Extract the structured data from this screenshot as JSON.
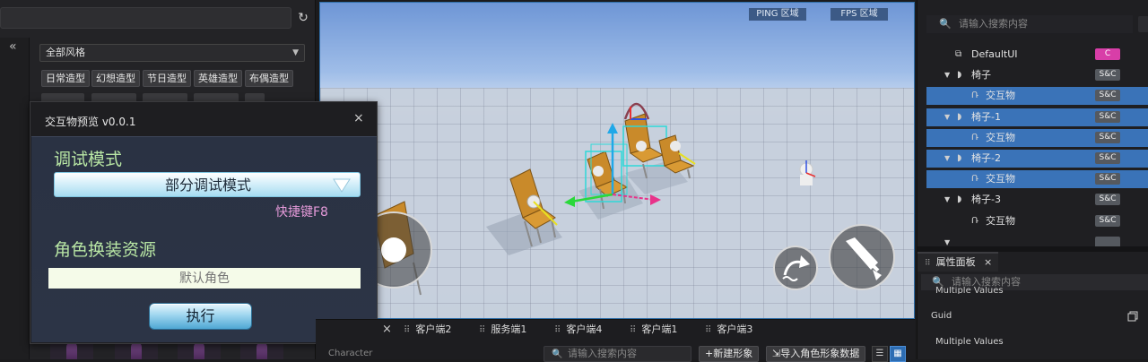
{
  "left_panel": {
    "refresh_icon": "↻",
    "collapse_icon": "«",
    "style_filter": "全部风格",
    "style_chips": [
      "日常造型",
      "幻想造型",
      "节日造型",
      "英雄造型",
      "布偶造型"
    ],
    "thumbnail_icon": "character-thumbnail"
  },
  "popup": {
    "title": "交互物预览 v0.0.1",
    "close": "×",
    "debug_section_label": "调试模式",
    "debug_mode_value": "部分调试模式",
    "shortcut_hint": "快捷键F8",
    "costume_section_label": "角色换装资源",
    "role_placeholder": "默认角色",
    "execute_label": "执行"
  },
  "viewport": {
    "ping_label": "PING 区域",
    "fps_label": "FPS 区域",
    "jump_button_icon": "jump-arrow-icon",
    "attack_button_icon": "sword-icon"
  },
  "bottom_bar": {
    "close": "×",
    "client_tabs": [
      "客户端2",
      "服务端1",
      "客户端4",
      "客户端1",
      "客户端3"
    ],
    "category_label": "Character",
    "search_placeholder": "请输入搜索内容",
    "new_costume_label": "新建形象",
    "new_costume_prefix": "+",
    "import_label": "导入角色形象数据",
    "import_prefix": "⇲"
  },
  "hierarchy": {
    "search_placeholder": "请输入搜索内容",
    "rows": [
      {
        "label": "DefaultUI",
        "badge": "C",
        "selected": false
      },
      {
        "label": "椅子",
        "badge": "S&C",
        "selected": false
      },
      {
        "label": "交互物",
        "badge": "S&C",
        "selected": true
      },
      {
        "label": "椅子-1",
        "badge": "S&C",
        "selected": true
      },
      {
        "label": "交互物",
        "badge": "S&C",
        "selected": true
      },
      {
        "label": "椅子-2",
        "badge": "S&C",
        "selected": true
      },
      {
        "label": "交互物",
        "badge": "S&C",
        "selected": true
      },
      {
        "label": "椅子-3",
        "badge": "S&C",
        "selected": false
      },
      {
        "label": "交互物",
        "badge": "S&C",
        "selected": false
      }
    ]
  },
  "properties": {
    "tab_label": "属性面板",
    "close": "×",
    "search_placeholder": "请输入搜索内容",
    "multi_values_1": "Multiple Values",
    "guid_label": "Guid",
    "multi_values_2": "Multiple Values"
  },
  "colors": {
    "selection": "#3a73b8",
    "badge_c": "#d83ea8",
    "section_label": "#b8e6a4",
    "shortcut": "#e49ad9"
  }
}
